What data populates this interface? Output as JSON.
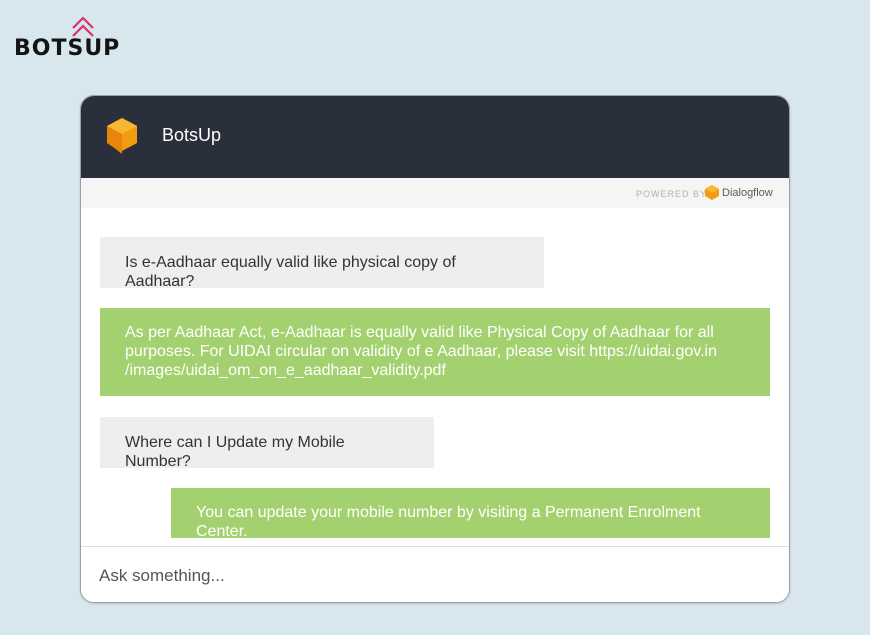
{
  "brand": {
    "logo_text": "BOTSUP"
  },
  "chat": {
    "title": "BotsUp",
    "powered_by_label": "POWERED BY",
    "powered_by_name": "Dialogflow",
    "messages": [
      {
        "role": "user",
        "text": "Is e-Aadhaar equally valid like physical copy of Aadhaar?"
      },
      {
        "role": "bot",
        "text": "As per Aadhaar Act, e-Aadhaar is equally valid like Physical Copy of Aadhaar for all purposes. For UIDAI circular on validity of e Aadhaar, please visit https://uidai.gov.in /images/uidai_om_on_e_aadhaar_validity.pdf"
      },
      {
        "role": "user",
        "text": "Where can I Update my Mobile Number?"
      },
      {
        "role": "bot",
        "text": "You can update your mobile number by visiting a Permanent Enrolment Center."
      }
    ],
    "input": {
      "value": "",
      "placeholder": "Ask something..."
    }
  },
  "colors": {
    "page_bg": "#d8e6ee",
    "header_bg": "#2a2f3c",
    "user_bubble": "#eeeeee",
    "bot_bubble": "#a4d16f",
    "avatar_orange": "#f39c12",
    "logo_pink": "#d6336c"
  },
  "icons": {
    "brand": "botsup-chevron-logo",
    "avatar": "dialogflow-cube-avatar",
    "powered": "dialogflow-logo"
  }
}
